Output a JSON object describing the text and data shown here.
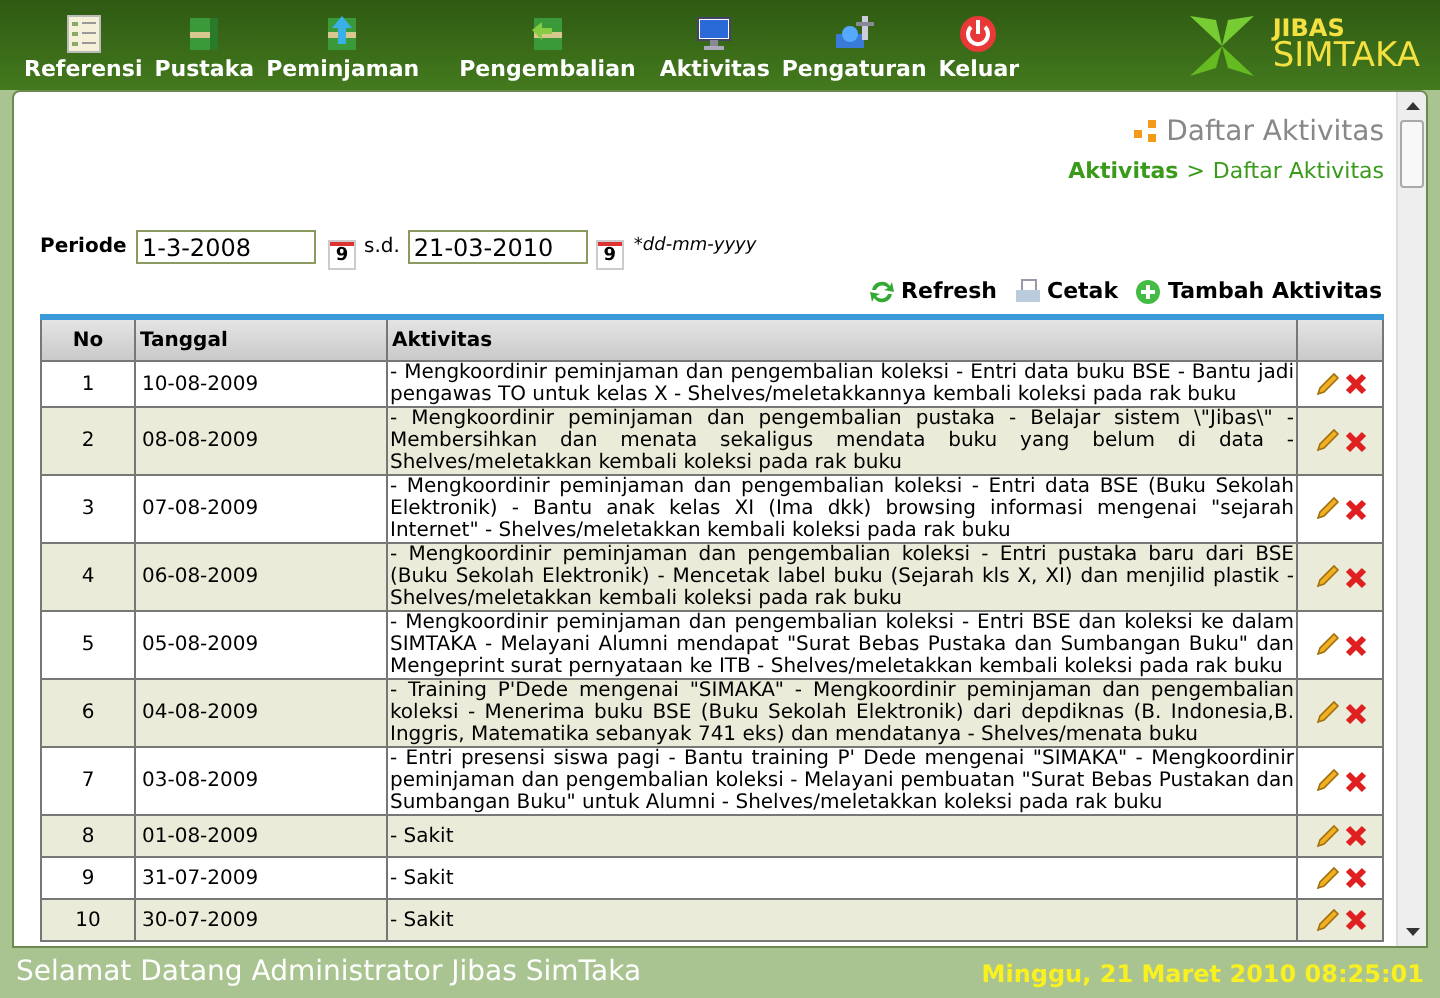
{
  "nav": [
    {
      "label": "Referensi"
    },
    {
      "label": "Pustaka"
    },
    {
      "label": "Peminjaman"
    },
    {
      "label": "Pengembalian"
    },
    {
      "label": "Aktivitas"
    },
    {
      "label": "Pengaturan"
    },
    {
      "label": "Keluar"
    }
  ],
  "logo": {
    "top": "JIBAS",
    "bottom": "SIMTAKA"
  },
  "page_title": "Daftar Aktivitas",
  "breadcrumb": {
    "current_section": "Aktivitas",
    "separator": ">",
    "page": "Daftar Aktivitas"
  },
  "filter": {
    "label": "Periode",
    "start": "1-3-2008",
    "calendar_day_1": "9",
    "separator": "s.d.",
    "end": "21-03-2010",
    "calendar_day_2": "9",
    "hint": "*dd-mm-yyyy"
  },
  "actions": [
    "Refresh",
    "Cetak",
    "Tambah Aktivitas"
  ],
  "table": {
    "columns": [
      "No",
      "Tanggal",
      "Aktivitas"
    ],
    "rows": [
      {
        "no": "1",
        "date": "10-08-2009",
        "activity": "- Mengkoordinir peminjaman dan pengembalian koleksi - Entri data buku BSE - Bantu jadi pengawas TO untuk kelas X - Shelves/meletakkannya kembali koleksi pada rak buku"
      },
      {
        "no": "2",
        "date": "08-08-2009",
        "activity": "- Mengkoordinir peminjaman dan pengembalian pustaka - Belajar sistem \\\"Jibas\\\" - Membersihkan dan menata sekaligus mendata buku yang belum di data - Shelves/meletakkan kembali koleksi pada rak buku"
      },
      {
        "no": "3",
        "date": "07-08-2009",
        "activity": "- Mengkoordinir peminjaman dan pengembalian koleksi - Entri data BSE (Buku Sekolah Elektronik) - Bantu anak kelas XI (Ima dkk) browsing informasi mengenai \"sejarah Internet\" - Shelves/meletakkan kembali koleksi pada rak buku"
      },
      {
        "no": "4",
        "date": "06-08-2009",
        "activity": "- Mengkoordinir peminjaman dan pengembalian koleksi - Entri pustaka baru dari BSE (Buku Sekolah Elektronik) - Mencetak label buku (Sejarah kls X, XI) dan menjilid plastik - Shelves/meletakkan kembali koleksi pada rak buku"
      },
      {
        "no": "5",
        "date": "05-08-2009",
        "activity": "- Mengkoordinir peminjaman dan pengembalian koleksi - Entri BSE dan koleksi ke dalam SIMTAKA - Melayani Alumni mendapat \"Surat Bebas Pustaka dan Sumbangan Buku\" dan Mengeprint surat pernyataan ke ITB - Shelves/meletakkan kembali koleksi pada rak buku"
      },
      {
        "no": "6",
        "date": "04-08-2009",
        "activity": "- Training P'Dede mengenai \"SIMAKA\" - Mengkoordinir peminjaman dan pengembalian koleksi - Menerima buku BSE (Buku Sekolah Elektronik) dari depdiknas (B. Indonesia,B. Inggris, Matematika sebanyak 741 eks) dan mendatanya - Shelves/menata buku"
      },
      {
        "no": "7",
        "date": "03-08-2009",
        "activity": "- Entri presensi siswa pagi - Bantu training P' Dede mengenai \"SIMAKA\" - Mengkoordinir peminjaman dan pengembalian koleksi - Melayani pembuatan \"Surat Bebas Pustakan dan Sumbangan Buku\" untuk Alumni - Shelves/meletakkan koleksi pada rak buku"
      },
      {
        "no": "8",
        "date": "01-08-2009",
        "activity": "- Sakit"
      },
      {
        "no": "9",
        "date": "31-07-2009",
        "activity": "- Sakit"
      },
      {
        "no": "10",
        "date": "30-07-2009",
        "activity": "- Sakit"
      }
    ]
  },
  "status_bar": {
    "welcome": "Selamat Datang Administrator Jibas SimTaka",
    "datetime": "Minggu, 21 Maret 2010 08:25:01"
  }
}
